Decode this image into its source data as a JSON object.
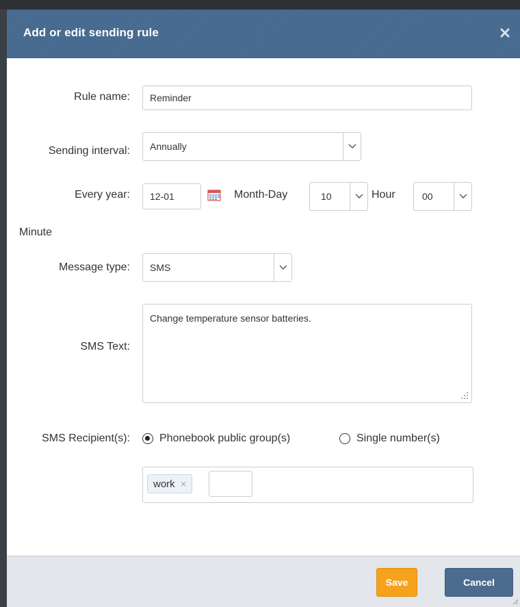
{
  "dialog": {
    "title": "Add or edit sending rule",
    "close_icon": "close-icon"
  },
  "form": {
    "rule_name": {
      "label": "Rule name:",
      "value": "Reminder"
    },
    "sending_interval": {
      "label": "Sending interval:",
      "value": "Annually"
    },
    "every_year": {
      "label": "Every year:",
      "date_value": "12-01",
      "date_icon": "calendar-icon",
      "month_day_label": "Month-Day",
      "hour_value": "10",
      "hour_label": "Hour",
      "minute_value": "00",
      "minute_label": "Minute"
    },
    "message_type": {
      "label": "Message type:",
      "value": "SMS"
    },
    "sms_text": {
      "label": "SMS Text:",
      "value": "Change temperature sensor batteries."
    },
    "recipients": {
      "label": "SMS Recipient(s):",
      "options": [
        {
          "label": "Phonebook public group(s)",
          "checked": true
        },
        {
          "label": "Single number(s)",
          "checked": false
        }
      ],
      "tags": [
        "work"
      ],
      "tag_remove": "×"
    }
  },
  "footer": {
    "save_label": "Save",
    "cancel_label": "Cancel"
  },
  "colors": {
    "title_bar": "#46698f",
    "save_button": "#f7a21c",
    "cancel_button": "#4c6c8f"
  }
}
